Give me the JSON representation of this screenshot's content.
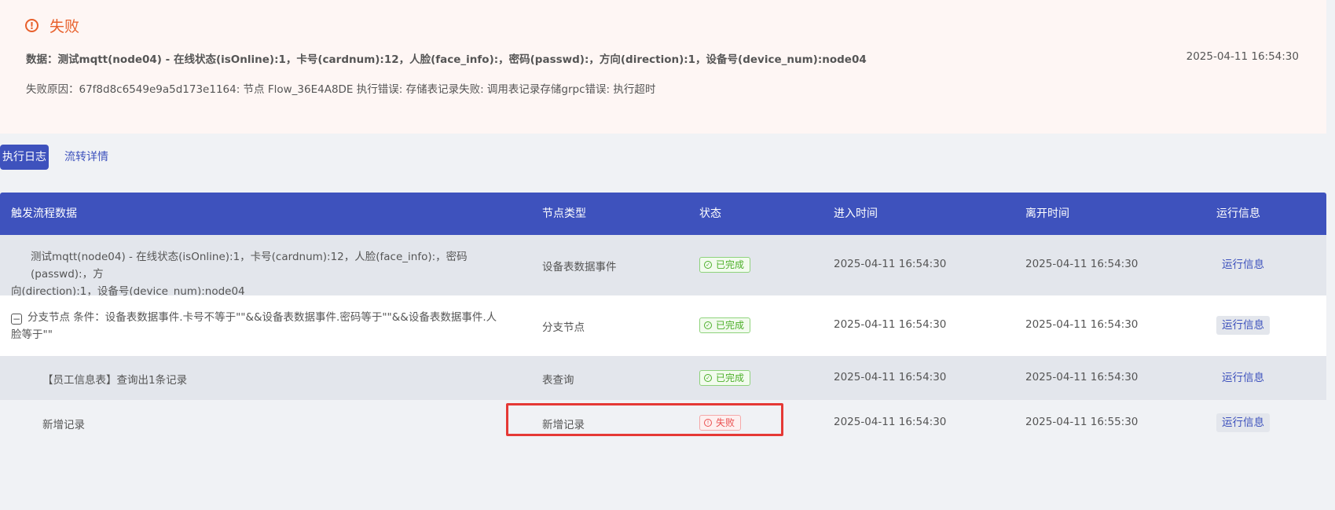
{
  "alert": {
    "title": "失败",
    "data_text": "数据：测试mqtt(node04) - 在线状态(isOnline):1，卡号(cardnum):12，人脸(face_info):，密码(passwd):，方向(direction):1，设备号(device_num):node04",
    "time": "2025-04-11 16:54:30",
    "reason": "失败原因：67f8d8c6549e9a5d173e1164: 节点 Flow_36E4A8DE 执行错误: 存储表记录失败: 调用表记录存储grpc错误: 执行超时",
    "icon": "alert-circle-icon",
    "color": "#e8602c"
  },
  "tabs": [
    {
      "label": "执行日志",
      "active": true
    },
    {
      "label": "流转详情",
      "active": false
    }
  ],
  "table": {
    "headers": [
      "触发流程数据",
      "节点类型",
      "状态",
      "进入时间",
      "离开时间",
      "运行信息"
    ],
    "rows": [
      {
        "data_line1": "测试mqtt(node04) - 在线状态(isOnline):1，卡号(cardnum):12，人脸(face_info):，密码(passwd):，方",
        "data_line2": "向(direction):1，设备号(device_num):node04",
        "node_type": "设备表数据事件",
        "status": "已完成",
        "enter_time": "2025-04-11 16:54:30",
        "leave_time": "2025-04-11 16:54:30",
        "run_info": "运行信息"
      },
      {
        "data_line1": "分支节点 条件：设备表数据事件.卡号不等于\"\"&&设备表数据事件.密码等于\"\"&&设备表数据事件.人",
        "data_line2": "脸等于\"\"",
        "node_type": "分支节点",
        "status": "已完成",
        "enter_time": "2025-04-11 16:54:30",
        "leave_time": "2025-04-11 16:54:30",
        "run_info": "运行信息"
      },
      {
        "data_line1": "【员工信息表】查询出1条记录",
        "node_type": "表查询",
        "status": "已完成",
        "enter_time": "2025-04-11 16:54:30",
        "leave_time": "2025-04-11 16:54:30",
        "run_info": "运行信息"
      },
      {
        "data_line1": "新增记录",
        "node_type": "新增记录",
        "status": "失败",
        "enter_time": "2025-04-11 16:54:30",
        "leave_time": "2025-04-11 16:55:30",
        "run_info": "运行信息"
      }
    ]
  },
  "colors": {
    "accent": "#3e52bd",
    "success": "#4caf2a",
    "failure": "#ea4f4f",
    "highlight_box": "#e53935"
  }
}
